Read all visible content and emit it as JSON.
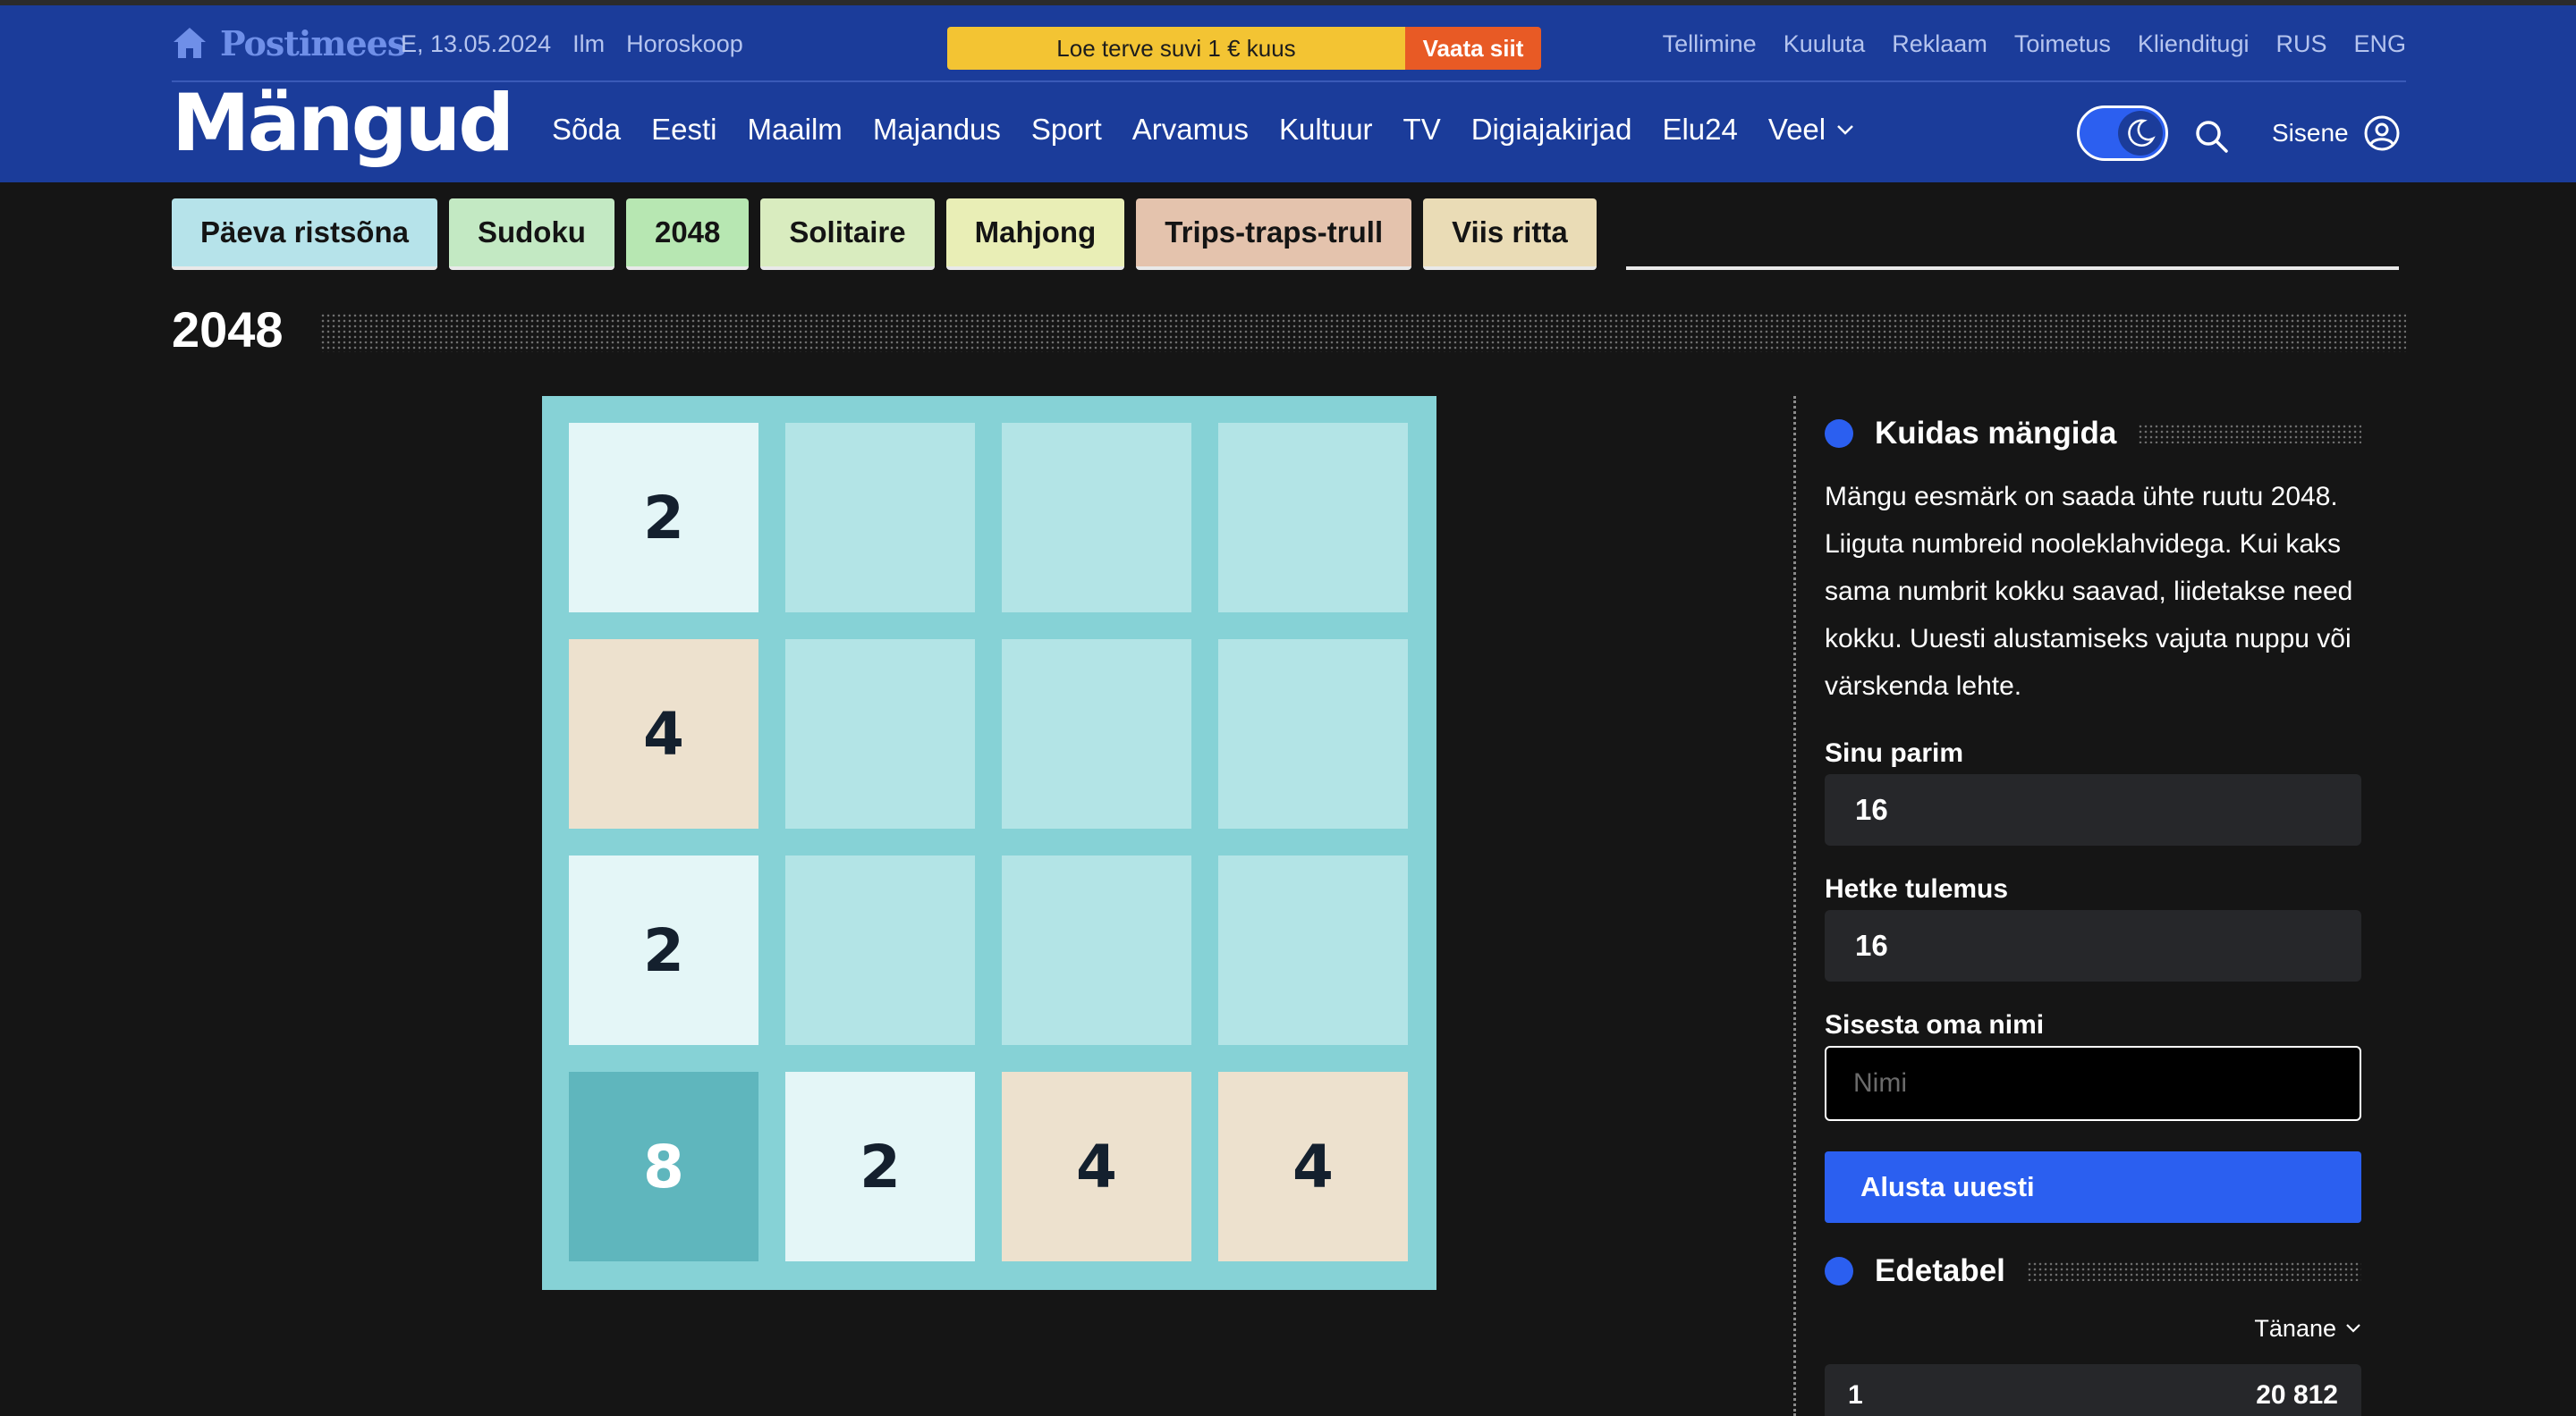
{
  "header": {
    "brand": "Postimees",
    "date": "E, 13.05.2024",
    "util_links": [
      "Ilm",
      "Horoskoop"
    ],
    "promo_text": "Loe terve suvi 1 € kuus",
    "promo_button": "Vaata siit",
    "right_links": [
      "Tellimine",
      "Kuuluta",
      "Reklaam",
      "Toimetus",
      "Klienditugi",
      "RUS",
      "ENG"
    ],
    "logo": "Mängud",
    "nav": [
      "Sõda",
      "Eesti",
      "Maailm",
      "Majandus",
      "Sport",
      "Arvamus",
      "Kultuur",
      "TV",
      "Digiajakirjad",
      "Elu24"
    ],
    "nav_more": "Veel",
    "signin": "Sisene",
    "icons": [
      "home-icon",
      "moon-icon",
      "search-icon",
      "user-icon",
      "chevron-down-icon"
    ]
  },
  "game_tabs": [
    {
      "label": "Päeva ristsõna",
      "color": "#b6e3ea"
    },
    {
      "label": "Sudoku",
      "color": "#c3e9c3"
    },
    {
      "label": "2048",
      "color": "#b7e7b2"
    },
    {
      "label": "Solitaire",
      "color": "#d9ecbf"
    },
    {
      "label": "Mahjong",
      "color": "#e9eeb6"
    },
    {
      "label": "Trips-traps-trull",
      "color": "#e4c3ad"
    },
    {
      "label": "Viis ritta",
      "color": "#eadcb6"
    }
  ],
  "page_title": "2048",
  "board": {
    "rows": [
      [
        "2",
        "",
        "",
        ""
      ],
      [
        "4",
        "",
        "",
        ""
      ],
      [
        "2",
        "",
        "",
        ""
      ],
      [
        "8",
        "2",
        "4",
        "4"
      ]
    ],
    "colors": {
      "empty": "#b3e4e6",
      "2": "#e4f6f7",
      "4": "#ede1ce",
      "8": "#5fb6bd",
      "frame": "#86d2d6"
    }
  },
  "sidebar": {
    "how_title": "Kuidas mängida",
    "how_text": "Mängu eesmärk on saada ühte ruutu 2048. Liiguta numbreid nooleklahvidega. Kui kaks sama numbrit kokku saavad, liidetakse need kokku. Uuesti alustamiseks vajuta nuppu või värskenda lehte.",
    "best_label": "Sinu parim",
    "best_value": "16",
    "current_label": "Hetke tulemus",
    "current_value": "16",
    "name_label": "Sisesta oma nimi",
    "name_placeholder": "Nimi",
    "restart_button": "Alusta uuesti",
    "leaderboard_title": "Edetabel",
    "period": "Tänane",
    "first_row_left": "1",
    "first_row_right": "20 812"
  }
}
